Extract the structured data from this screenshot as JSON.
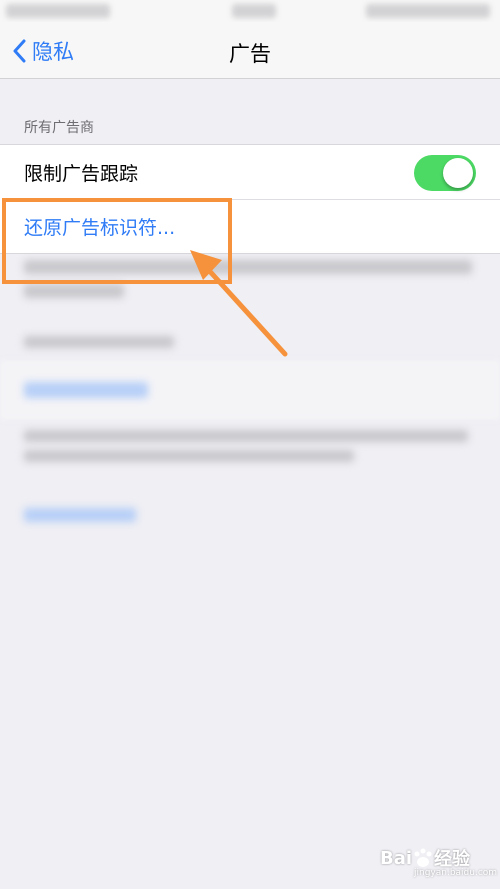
{
  "nav": {
    "back_label": "隐私",
    "title": "广告"
  },
  "section": {
    "header": "所有广告商"
  },
  "rows": {
    "limit_ad_tracking": "限制广告跟踪",
    "limit_ad_tracking_on": true,
    "reset_identifier": "还原广告标识符..."
  },
  "watermark": {
    "brand": "Bai",
    "suffix": "经验",
    "url": "jingyan.baidu.com"
  },
  "colors": {
    "accent": "#2f7cf6",
    "toggle_on": "#4cd964",
    "annotation": "#f6923b",
    "background": "#efeff4"
  }
}
